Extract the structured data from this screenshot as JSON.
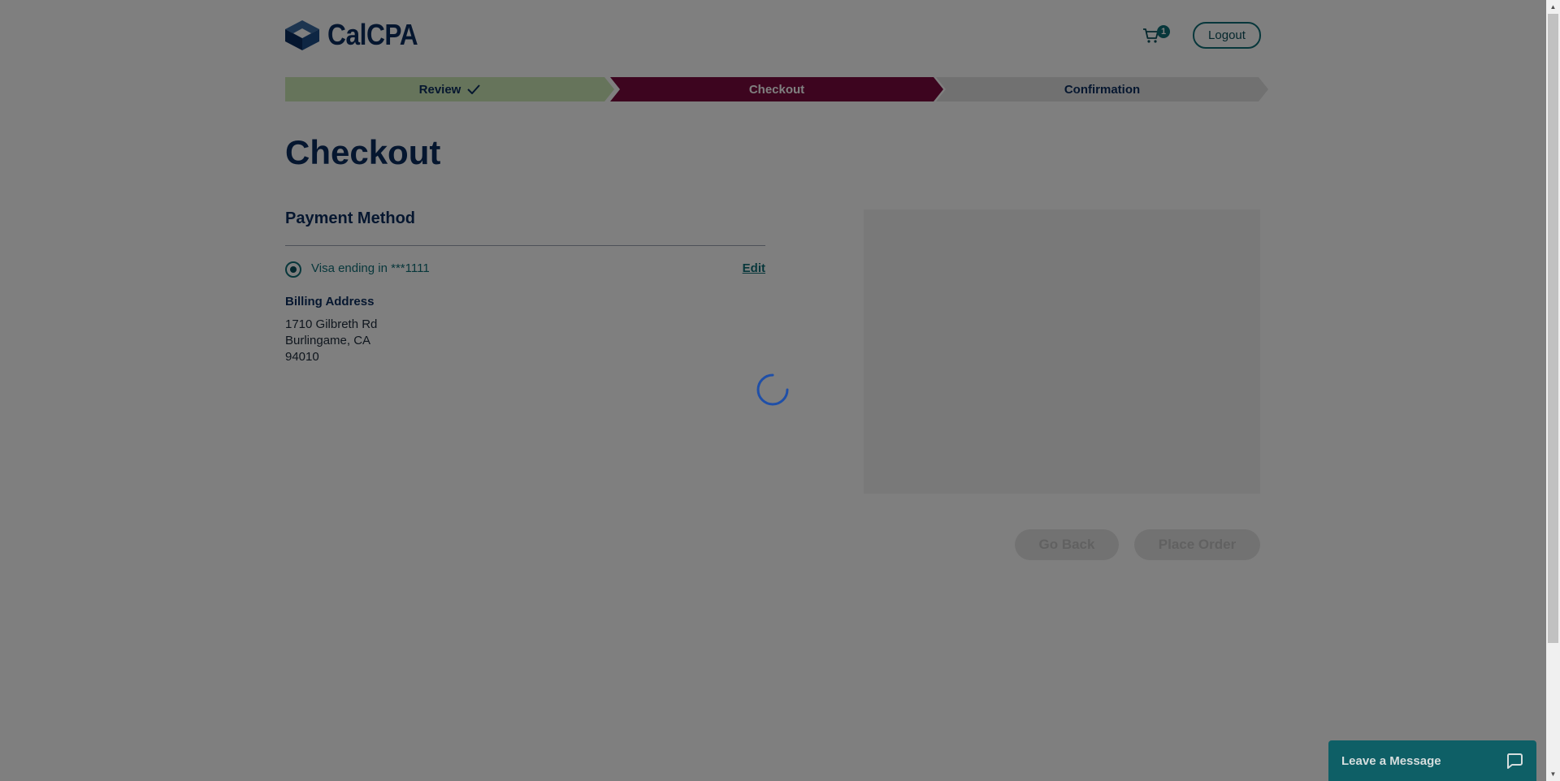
{
  "header": {
    "logo_text": "CalCPA",
    "cart_count": "1",
    "logout_label": "Logout"
  },
  "steps": [
    {
      "label": "Review",
      "state": "complete"
    },
    {
      "label": "Checkout",
      "state": "active"
    },
    {
      "label": "Confirmation",
      "state": "pending"
    }
  ],
  "main": {
    "title": "Checkout",
    "payment_section_title": "Payment Method",
    "payment_option": {
      "label": "Visa ending in ***1111",
      "selected": true
    },
    "edit_label": "Edit",
    "billing_title": "Billing Address",
    "billing_address": {
      "line1": "1710 Gilbreth Rd",
      "line2": "Burlingame, CA",
      "line3": "94010"
    }
  },
  "actions": {
    "go_back_label": "Go Back",
    "place_order_label": "Place Order"
  },
  "chat": {
    "label": "Leave a Message"
  },
  "state": {
    "loading": true
  },
  "colors": {
    "brand_navy": "#0b2d5f",
    "teal": "#0e6e77",
    "step_complete": "#cde8b6",
    "step_active": "#7a0a3f",
    "step_pending": "#e3e3e3"
  },
  "icons": [
    "calcpa-logo-icon",
    "cart-icon",
    "checkmark-icon",
    "spinner-icon",
    "chat-bubble-icon"
  ]
}
